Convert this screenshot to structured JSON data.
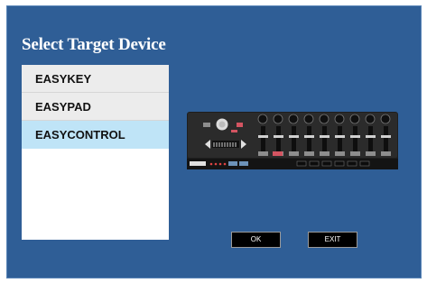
{
  "title": "Select Target Device",
  "devices": [
    {
      "label": "EASYKEY",
      "selected": false
    },
    {
      "label": "EASYPAD",
      "selected": false
    },
    {
      "label": "EASYCONTROL",
      "selected": true
    }
  ],
  "buttons": {
    "ok": "OK",
    "exit": "EXIT"
  },
  "colors": {
    "background": "#2f5e96",
    "selected": "#bfe4f7",
    "item": "#ececec",
    "button": "#000000"
  },
  "image": {
    "alt": "EASYCONTROL device image",
    "icon": "midi-controller-icon"
  }
}
